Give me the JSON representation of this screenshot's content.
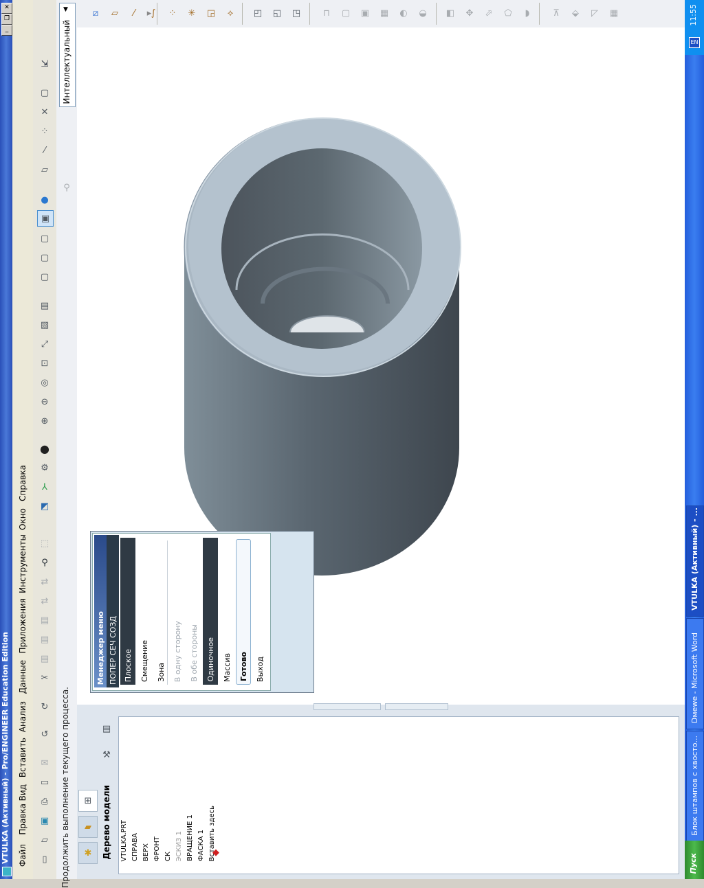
{
  "window": {
    "title": "VTULKA (Активный) - Pro/ENGINEER Education Edition"
  },
  "menubar": [
    "Файл",
    "Правка",
    "Вид",
    "Вставить",
    "Анализ",
    "Данные",
    "Приложения",
    "Инструменты",
    "Окно",
    "Справка"
  ],
  "smart_select": {
    "label": "Интеллектуальный"
  },
  "status_message": "Продолжить выполнение текущего процесса.",
  "model_tree": {
    "title": "Дерево модели",
    "nodes": [
      {
        "label": "VTULKA.PRT",
        "dim": false
      },
      {
        "label": "СПРАВА",
        "dim": false
      },
      {
        "label": "ВЕРХ",
        "dim": false
      },
      {
        "label": "ФРОНТ",
        "dim": false
      },
      {
        "label": "СК",
        "dim": false
      },
      {
        "label": "ЭСКИЗ 1",
        "dim": true
      },
      {
        "label": "ВРАЩЕНИЕ 1",
        "dim": false
      },
      {
        "label": "ФАСКА 1",
        "dim": false
      },
      {
        "label": "Вставить здесь",
        "dim": false
      }
    ]
  },
  "menu_manager": {
    "title": "Менеджер меню",
    "section": "ПОПЕР СЕЧ СОЗД",
    "items": [
      {
        "label": "Плоское",
        "state": "selected"
      },
      {
        "label": "Смещение",
        "state": "normal"
      },
      {
        "label": "Зона",
        "state": "normal"
      },
      {
        "label": "В одну сторону",
        "state": "disabled"
      },
      {
        "label": "В обе стороны",
        "state": "disabled"
      },
      {
        "label": "Одиночное",
        "state": "selected"
      },
      {
        "label": "Массив",
        "state": "normal"
      },
      {
        "label": "Готово",
        "state": "focused"
      },
      {
        "label": "Выход",
        "state": "normal"
      }
    ]
  },
  "taskbar": {
    "start": "Пуск",
    "tasks": [
      "Блок штампов с хвосто...",
      "Dмеwe - Microsoft Word",
      "VTULKA (Активный) - ..."
    ],
    "lang": "EN",
    "clock": "11:55"
  }
}
